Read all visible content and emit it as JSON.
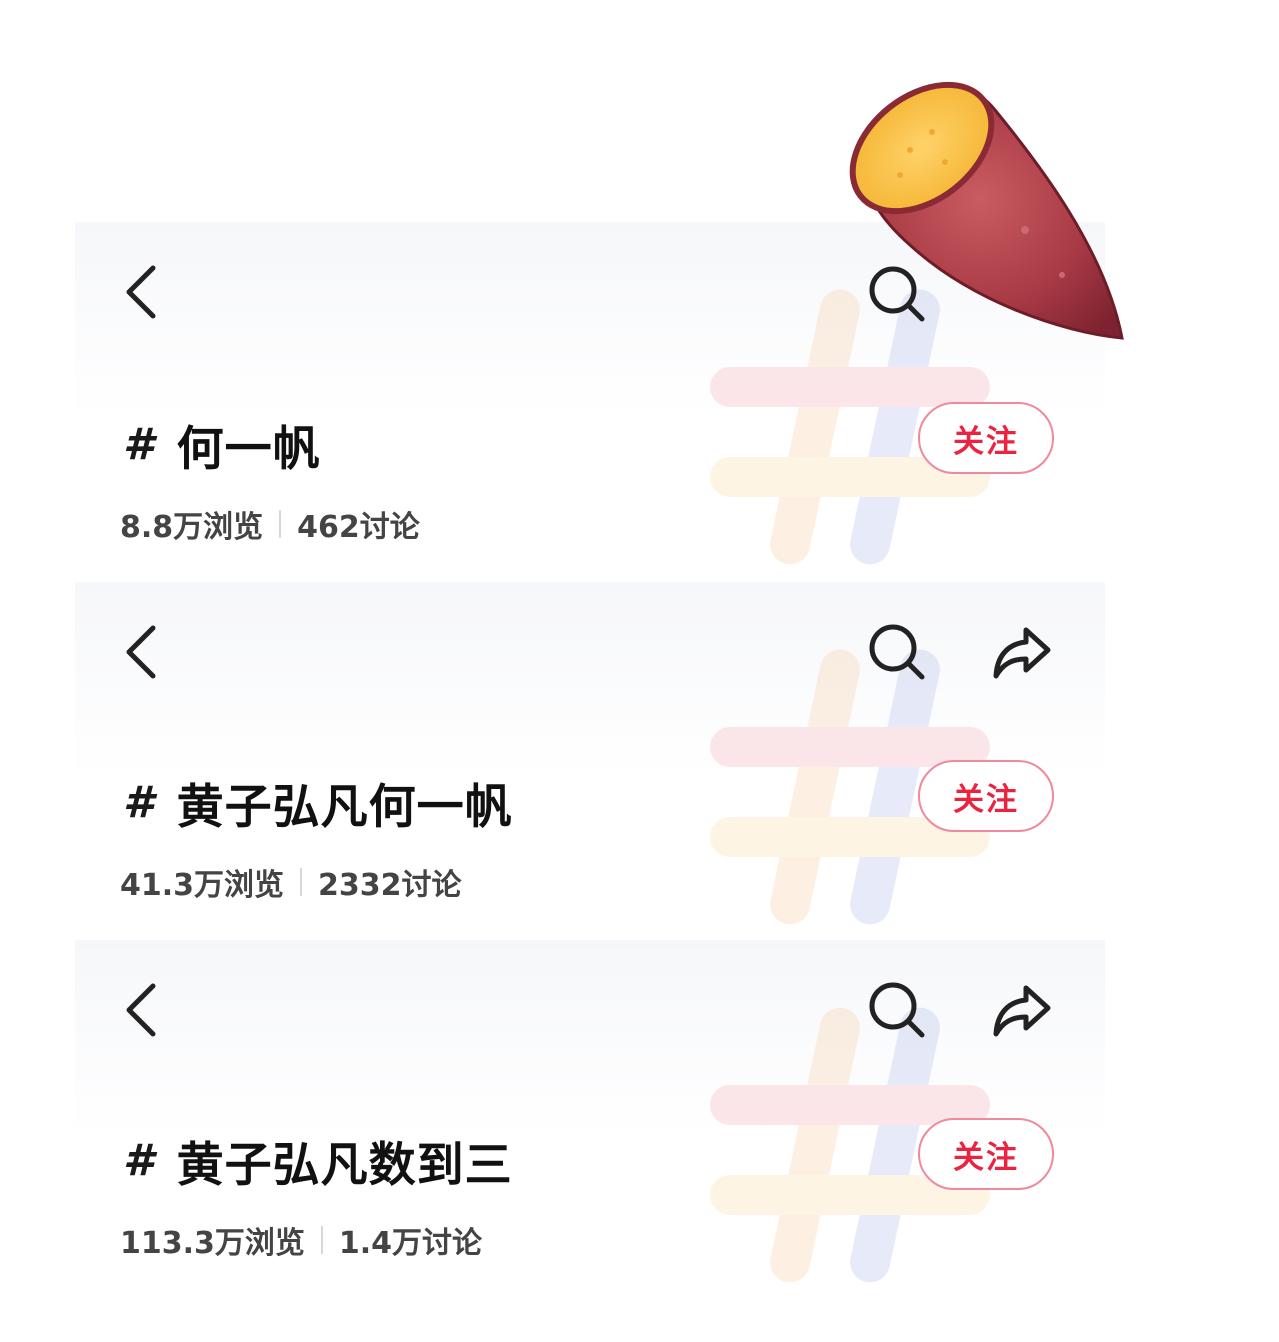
{
  "topics": [
    {
      "hash": "#",
      "title": "何一帆",
      "views": "8.8万浏览",
      "discussions": "462讨论",
      "follow_label": "关注"
    },
    {
      "hash": "#",
      "title": "黄子弘凡何一帆",
      "views": "41.3万浏览",
      "discussions": "2332讨论",
      "follow_label": "关注"
    },
    {
      "hash": "#",
      "title": "黄子弘凡数到三",
      "views": "113.3万浏览",
      "discussions": "1.4万讨论",
      "follow_label": "关注"
    }
  ],
  "icons": {
    "back": "chevron-left-icon",
    "search": "search-icon",
    "share": "share-icon",
    "sticker": "sweet-potato-sticker"
  },
  "colors": {
    "follow_text": "#ea2340",
    "follow_border": "#f0899b",
    "title": "#111111",
    "stats": "#444444"
  }
}
